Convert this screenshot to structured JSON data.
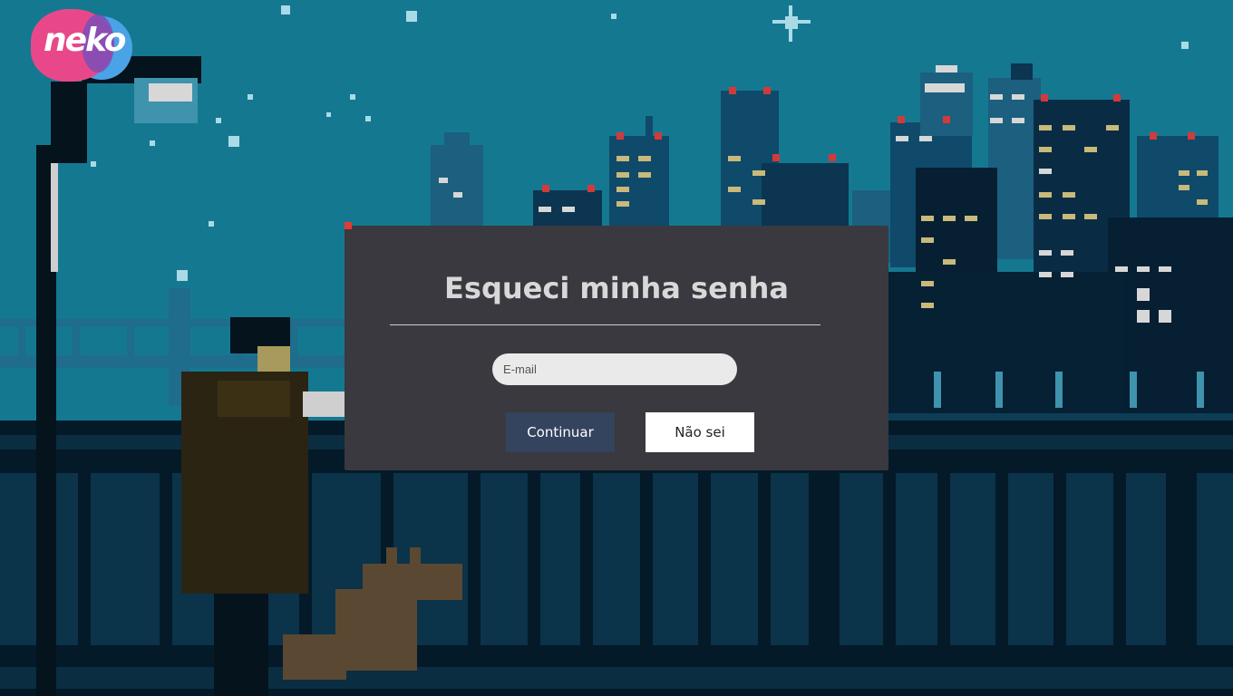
{
  "logo": {
    "text": "neko"
  },
  "modal": {
    "title": "Esqueci minha senha",
    "email_placeholder": "E-mail",
    "email_value": "",
    "continue_label": "Continuar",
    "dont_know_label": "Não sei"
  },
  "colors": {
    "sky": "#157891",
    "modal_bg": "#39393f",
    "continue_button": "#34435e",
    "accent_pink": "#e8488a",
    "accent_blue": "#4aa3e6"
  }
}
